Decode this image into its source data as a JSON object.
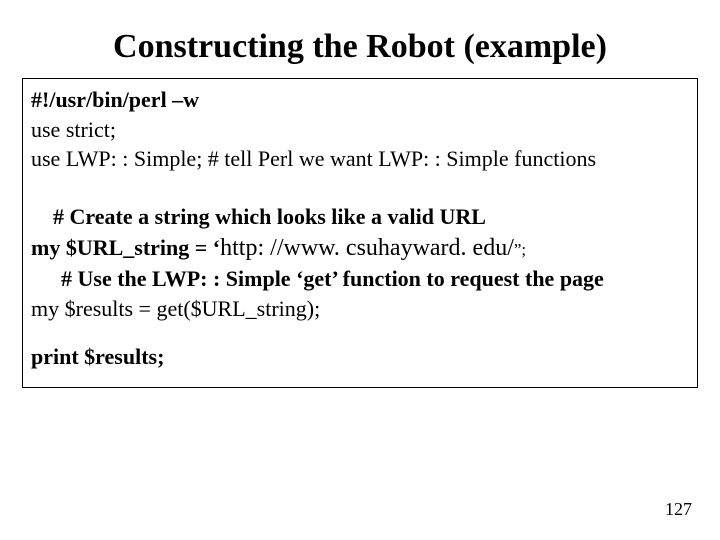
{
  "title": "Constructing the Robot (example)",
  "code": {
    "l1": "#!/usr/bin/perl –w",
    "l2": "use strict;",
    "l3": "use LWP: : Simple;  # tell Perl we want LWP: : Simple functions",
    "l4": "# Create a string which looks like a valid URL",
    "l5a": "my $URL_string = ‘",
    "l5b": "http: //www. csuhayward. edu/",
    "l5c": "”;",
    "l6": "# Use the LWP: : Simple ‘get’ function to request the page",
    "l7": "my $results = get($URL_string);",
    "l8": "print $results;"
  },
  "page_number": "127"
}
